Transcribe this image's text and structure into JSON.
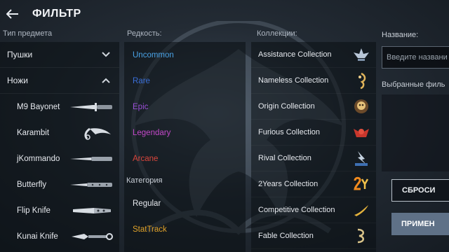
{
  "header": {
    "title": "ФИЛЬТР"
  },
  "columns": {
    "type_label": "Тип предмета",
    "rarity_label": "Редкость:",
    "collections_label": "Коллекции:",
    "name_label": "Название:"
  },
  "item_types": [
    {
      "label": "Пушки",
      "expanded": false
    },
    {
      "label": "Ножи",
      "expanded": true
    }
  ],
  "knives": [
    {
      "label": "M9 Bayonet",
      "icon": "m9-bayonet-icon"
    },
    {
      "label": "Karambit",
      "icon": "karambit-icon"
    },
    {
      "label": "jKommando",
      "icon": "jkommando-icon"
    },
    {
      "label": "Butterfly",
      "icon": "butterfly-icon"
    },
    {
      "label": "Flip Knife",
      "icon": "flip-knife-icon"
    },
    {
      "label": "Kunai Knife",
      "icon": "kunai-knife-icon"
    }
  ],
  "rarities": [
    {
      "label": "Uncommon",
      "color": "#4aa3e6"
    },
    {
      "label": "Rare",
      "color": "#3a6fd8"
    },
    {
      "label": "Epic",
      "color": "#9a4fd6"
    },
    {
      "label": "Legendary",
      "color": "#c248c8"
    },
    {
      "label": "Arcane",
      "color": "#d9463c"
    }
  ],
  "category": {
    "label": "Категория",
    "options": [
      {
        "label": "Regular",
        "color": "#e6e9ee"
      },
      {
        "label": "StatTrack",
        "color": "#e0a22a"
      }
    ]
  },
  "collections": [
    {
      "label": "Assistance Collection",
      "icon": "assistance-badge-icon"
    },
    {
      "label": "Nameless Collection",
      "icon": "nameless-badge-icon"
    },
    {
      "label": "Origin Collection",
      "icon": "origin-badge-icon"
    },
    {
      "label": "Furious Collection",
      "icon": "furious-badge-icon"
    },
    {
      "label": "Rival Collection",
      "icon": "rival-badge-icon"
    },
    {
      "label": "2Years Collection",
      "icon": "2years-badge-icon"
    },
    {
      "label": "Competitive Collection",
      "icon": "competitive-badge-icon"
    },
    {
      "label": "Fable Collection",
      "icon": "fable-badge-icon"
    }
  ],
  "search": {
    "placeholder": "Введите названи"
  },
  "selected": {
    "label": "Выбранные филь"
  },
  "buttons": {
    "reset": "СБРОСИ",
    "apply": "ПРИМЕН"
  }
}
